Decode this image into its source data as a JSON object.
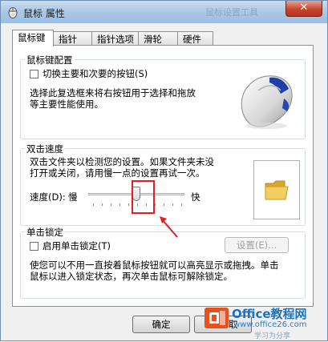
{
  "window": {
    "title": "鼠标 属性",
    "title_ghost": "鼠标设置工具",
    "close_glyph": "✕"
  },
  "tabs": [
    {
      "label": "鼠标键"
    },
    {
      "label": "指针"
    },
    {
      "label": "指针选项"
    },
    {
      "label": "滑轮"
    },
    {
      "label": "硬件"
    }
  ],
  "button_config": {
    "title": "鼠标键配置",
    "swap_label": "切换主要和次要的按钮(S)",
    "swap_checked": false,
    "desc_line1": "选择此复选框来将右按钮用于选择和拖放",
    "desc_line2": "等主要性能使用。"
  },
  "double_click": {
    "title": "双击速度",
    "desc_line1": "双击文件夹以检测您的设置。如果文件夹未没",
    "desc_line2": "打开或关闭，请用慢一点的设置再试一次。",
    "speed_label": "速度(D):",
    "slow_label": "慢",
    "fast_label": "快",
    "speed_fraction": 0.5
  },
  "click_lock": {
    "title": "单击锁定",
    "enable_label": "启用单击锁定(T)",
    "enable_checked": false,
    "settings_button": "设置(E)...",
    "desc_line1": "使您可以不用一直按着鼠标按钮就可以高亮显示或拖拽。单击",
    "desc_line2": "鼠标以进入锁定状态，再次单击鼠标可解除锁定。"
  },
  "footer": {
    "ok_button": "确定",
    "cancel_fragment": "取"
  },
  "watermark": {
    "brand_line1": "Office教程网",
    "brand_line2": "www.office26.com",
    "overlay_text": "学习为分享",
    "accent_color": "#e8501c"
  },
  "annotation": {
    "color": "#e51c23"
  }
}
